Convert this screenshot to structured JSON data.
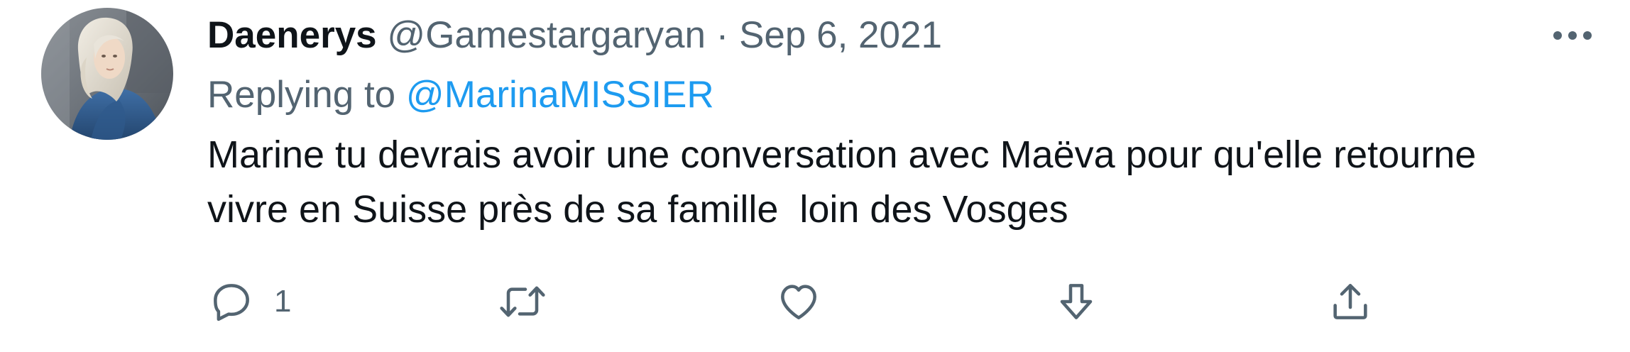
{
  "tweet": {
    "display_name": "Daenerys",
    "handle": "@Gamestargaryan",
    "separator": "·",
    "date": "Sep 6, 2021",
    "replying_prefix": "Replying to",
    "replying_to": "@MarinaMISSIER",
    "text": "Marine tu devrais avoir une conversation avec Maëva pour qu'elle retourne\nvivre en Suisse près de sa famille  loin des Vosges"
  },
  "actions": {
    "reply_count": "1"
  },
  "icons": {
    "more": "more-horizontal-icon",
    "reply": "speech-bubble-icon",
    "retweet": "retweet-arrows-icon",
    "like": "heart-icon",
    "downvote": "down-arrow-icon",
    "share": "upload-share-icon"
  },
  "colors": {
    "text_primary": "#0f1419",
    "text_secondary": "#536471",
    "link": "#1d9bf0",
    "background": "#ffffff"
  }
}
